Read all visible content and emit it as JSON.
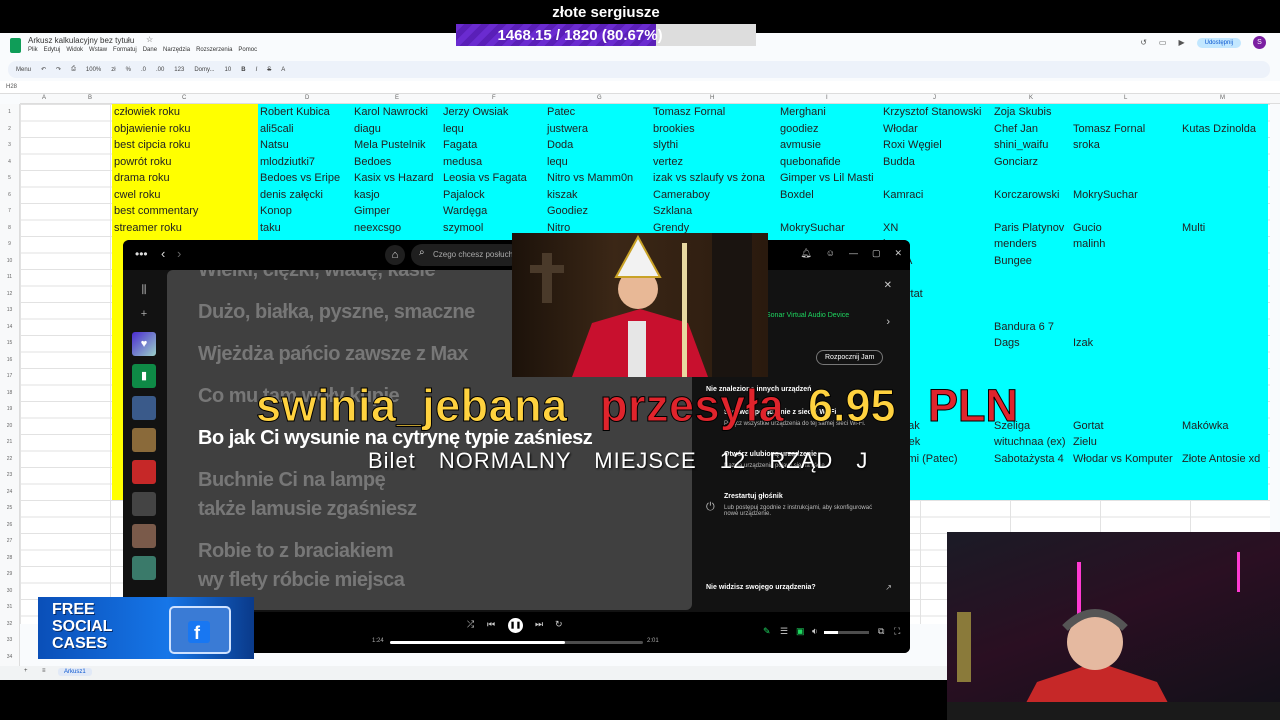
{
  "sheets": {
    "doc_title": "Arkusz kalkulacyjny bez tytułu",
    "menu": [
      "Plik",
      "Edytuj",
      "Widok",
      "Wstaw",
      "Formatuj",
      "Dane",
      "Narzędzia",
      "Rozszerzenia",
      "Pomoc"
    ],
    "share_label": "Udostępnij",
    "account_initial": "S",
    "toolbar": {
      "menu_label": "Menu",
      "zoom": "100%",
      "currency": "zł",
      "percent": "%",
      "dec_less": ".0",
      "dec_more": ".00",
      "number_fmt": "123",
      "font": "Domy...",
      "font_size": "10"
    },
    "cell_ref": "H28",
    "col_letters": [
      "A",
      "B",
      "C",
      "D",
      "E",
      "F",
      "G",
      "H",
      "I",
      "J",
      "K",
      "L",
      "M"
    ],
    "rows": [
      "1",
      "2",
      "3",
      "4",
      "5",
      "6",
      "7",
      "8",
      "9",
      "10",
      "11",
      "12",
      "13",
      "14",
      "15",
      "16",
      "17",
      "18",
      "19",
      "20",
      "21",
      "22",
      "23",
      "24",
      "25",
      "26",
      "27",
      "28",
      "29",
      "30",
      "31",
      "32",
      "33",
      "34",
      "35"
    ],
    "cells": [
      {
        "text": "człowiek roku",
        "col": 2,
        "row": 0
      },
      {
        "text": "objawienie roku",
        "col": 2,
        "row": 1
      },
      {
        "text": "best cipcia roku",
        "col": 2,
        "row": 2
      },
      {
        "text": "powrót roku",
        "col": 2,
        "row": 3
      },
      {
        "text": "drama roku",
        "col": 2,
        "row": 4
      },
      {
        "text": "cwel roku",
        "col": 2,
        "row": 5
      },
      {
        "text": "best commentary",
        "col": 2,
        "row": 6
      },
      {
        "text": "streamer roku",
        "col": 2,
        "row": 7
      },
      {
        "text": "Robert Kubica",
        "col": 3,
        "row": 0
      },
      {
        "text": "ali5cali",
        "col": 3,
        "row": 1
      },
      {
        "text": "Natsu",
        "col": 3,
        "row": 2
      },
      {
        "text": "mlodziutki7",
        "col": 3,
        "row": 3
      },
      {
        "text": "Bedoes vs Eripe",
        "col": 3,
        "row": 4
      },
      {
        "text": "denis załęcki",
        "col": 3,
        "row": 5
      },
      {
        "text": "Konop",
        "col": 3,
        "row": 6
      },
      {
        "text": "taku",
        "col": 3,
        "row": 7
      },
      {
        "text": "Karol Nawrocki",
        "col": 4,
        "row": 0
      },
      {
        "text": "diagu",
        "col": 4,
        "row": 1
      },
      {
        "text": "Mela Pustelnik",
        "col": 4,
        "row": 2
      },
      {
        "text": "Bedoes",
        "col": 4,
        "row": 3
      },
      {
        "text": "Kasix vs Hazard",
        "col": 4,
        "row": 4
      },
      {
        "text": "kasjo",
        "col": 4,
        "row": 5
      },
      {
        "text": "Gimper",
        "col": 4,
        "row": 6
      },
      {
        "text": "neexcsgo",
        "col": 4,
        "row": 7
      },
      {
        "text": "Jerzy Owsiak",
        "col": 5,
        "row": 0
      },
      {
        "text": "lequ",
        "col": 5,
        "row": 1
      },
      {
        "text": "Fagata",
        "col": 5,
        "row": 2
      },
      {
        "text": "medusa",
        "col": 5,
        "row": 3
      },
      {
        "text": "Leosia vs Fagata",
        "col": 5,
        "row": 4
      },
      {
        "text": "Pajalock",
        "col": 5,
        "row": 5
      },
      {
        "text": "Wardęga",
        "col": 5,
        "row": 6
      },
      {
        "text": "szymool",
        "col": 5,
        "row": 7
      },
      {
        "text": "Patec",
        "col": 6,
        "row": 0
      },
      {
        "text": "justwera",
        "col": 6,
        "row": 1
      },
      {
        "text": "Doda",
        "col": 6,
        "row": 2
      },
      {
        "text": "lequ",
        "col": 6,
        "row": 3
      },
      {
        "text": "Nitro vs Mamm0n",
        "col": 6,
        "row": 4
      },
      {
        "text": "kiszak",
        "col": 6,
        "row": 5
      },
      {
        "text": "Goodiez",
        "col": 6,
        "row": 6
      },
      {
        "text": "Nitro",
        "col": 6,
        "row": 7
      },
      {
        "text": "Tomasz Fornal",
        "col": 7,
        "row": 0
      },
      {
        "text": "brookies",
        "col": 7,
        "row": 1
      },
      {
        "text": "slythi",
        "col": 7,
        "row": 2
      },
      {
        "text": "vertez",
        "col": 7,
        "row": 3
      },
      {
        "text": "izak vs szlaufy vs żona",
        "col": 7,
        "row": 4
      },
      {
        "text": "Cameraboy",
        "col": 7,
        "row": 5
      },
      {
        "text": "Szklana",
        "col": 7,
        "row": 6
      },
      {
        "text": "Grendy",
        "col": 7,
        "row": 7
      },
      {
        "text": "Merghani",
        "col": 8,
        "row": 0
      },
      {
        "text": "goodiez",
        "col": 8,
        "row": 1
      },
      {
        "text": "avmusie",
        "col": 8,
        "row": 2
      },
      {
        "text": "quebonafide",
        "col": 8,
        "row": 3
      },
      {
        "text": "Gimper vs Lil Masti",
        "col": 8,
        "row": 4
      },
      {
        "text": "Boxdel",
        "col": 8,
        "row": 5
      },
      {
        "text": "MokrySuchar",
        "col": 8,
        "row": 7
      },
      {
        "text": "Krzysztof Stanowski",
        "col": 9,
        "row": 0
      },
      {
        "text": "Włodar",
        "col": 9,
        "row": 1
      },
      {
        "text": "Roxi Węgiel",
        "col": 9,
        "row": 2
      },
      {
        "text": "Budda",
        "col": 9,
        "row": 3
      },
      {
        "text": "Kamraci",
        "col": 9,
        "row": 5
      },
      {
        "text": "XN",
        "col": 9,
        "row": 7
      },
      {
        "text": "Zoja Skubis",
        "col": 10,
        "row": 0
      },
      {
        "text": "Chef Jan",
        "col": 10,
        "row": 1
      },
      {
        "text": "shini_waifu",
        "col": 10,
        "row": 2
      },
      {
        "text": "Gonciarz",
        "col": 10,
        "row": 3
      },
      {
        "text": "Korczarowski",
        "col": 10,
        "row": 5
      },
      {
        "text": "Paris Platynov",
        "col": 10,
        "row": 7
      },
      {
        "text": "menders",
        "col": 10,
        "row": 8
      },
      {
        "text": "Bungee",
        "col": 10,
        "row": 9
      },
      {
        "text": "Bandura 6 7",
        "col": 10,
        "row": 13
      },
      {
        "text": "Dags",
        "col": 10,
        "row": 14
      },
      {
        "text": "Szeliga",
        "col": 10,
        "row": 19
      },
      {
        "text": "wituchnaa (ex)",
        "col": 10,
        "row": 20
      },
      {
        "text": "Sabotażysta 4",
        "col": 10,
        "row": 21
      },
      {
        "text": "Tomasz Fornal",
        "col": 11,
        "row": 1
      },
      {
        "text": "sroka",
        "col": 11,
        "row": 2
      },
      {
        "text": "MokrySuchar",
        "col": 11,
        "row": 5
      },
      {
        "text": "Gucio",
        "col": 11,
        "row": 7
      },
      {
        "text": "malinh",
        "col": 11,
        "row": 8
      },
      {
        "text": "Izak",
        "col": 11,
        "row": 14
      },
      {
        "text": "Gortat",
        "col": 11,
        "row": 19
      },
      {
        "text": "Zielu",
        "col": 11,
        "row": 20
      },
      {
        "text": "Włodar vs Komputer",
        "col": 11,
        "row": 21
      },
      {
        "text": "Kutas Dzinolda",
        "col": 12,
        "row": 1
      },
      {
        "text": "Multi",
        "col": 12,
        "row": 7
      },
      {
        "text": "Makówka",
        "col": 12,
        "row": 19
      },
      {
        "text": "Złote Antosie xd",
        "col": 12,
        "row": 21
      },
      {
        "text": "ka",
        "col": 9,
        "row": 8
      },
      {
        "text": "APSA",
        "col": 9,
        "row": 9
      },
      {
        "text": "i tv",
        "col": 9,
        "row": 10
      },
      {
        "text": "n Gortat",
        "col": 9,
        "row": 11
      },
      {
        "text": "B",
        "col": 9,
        "row": 12
      },
      {
        "text": "ez",
        "col": 9,
        "row": 13
      },
      {
        "text": "m0n",
        "col": 9,
        "row": 14
      },
      {
        "text": "ies",
        "col": 9,
        "row": 15
      },
      {
        "text": "maxi",
        "col": 9,
        "row": 17
      },
      {
        "text": "n Polak",
        "col": 9,
        "row": 19
      },
      {
        "text": "Jadziek",
        "col": 9,
        "row": 20
      },
      {
        "text": "a Ziemi (Patec)",
        "col": 9,
        "row": 21
      },
      {
        "text": "zen",
        "col": 9,
        "row": 23
      }
    ],
    "sheet_tab": "Arkusz1"
  },
  "goal": {
    "title": "złote sergiusze",
    "progress_text": "1468.15 / 1820 (80.67%)",
    "current": 1468.15,
    "target": 1820,
    "percent": 80.67
  },
  "spotify": {
    "search_placeholder": "Czego chcesz posłuchać?",
    "lyrics": [
      {
        "text": "Wielki, ciężki, władę, kasie",
        "active": false
      },
      {
        "text": "Dużo, białka, pyszne, smaczne",
        "active": false
      },
      {
        "text": "Wjeżdża pańcio zawsze z Max",
        "active": false
      },
      {
        "text": "Co mu tam woły kupie",
        "active": false
      },
      {
        "text": "Bo jak Ci wysunie na cytrynę typie zaśniesz",
        "active": true
      },
      {
        "text": "Buchnie Ci na lampę",
        "active": false
      },
      {
        "text": "także lamusie zgaśniesz",
        "active": false
      },
      {
        "text": "Robie to z braciakiem",
        "active": false
      },
      {
        "text": "wy flety róbcie miejsca",
        "active": false
      }
    ],
    "devices": {
      "device_name": "Sonar Virtual Audio Device",
      "jam_label": "Rozpocznij Jam",
      "no_devices": "Nie znaleziono innych urządzeń",
      "check_wifi": "Sprawdź połączenie z siecią Wi-Fi",
      "check_wifi_sub": "Połącz wszystkie urządzenia do tej samej sieci Wi-Fi.",
      "open_app": "Otwórz ulubioną urządzenie",
      "open_app_sub": "Nazwa urządzenia pojawi się na liście.",
      "restart": "Zrestartuj głośnik",
      "restart_sub": "Lub postępuj zgodnie z instrukcjami, aby skonfigurować nowe urządzenie.",
      "cant_see": "Nie widzisz swojego urządzenia?"
    },
    "time_elapsed": "1:24",
    "time_total": "2:01",
    "progress_fraction": 0.69,
    "volume_fraction": 0.3
  },
  "donation": {
    "name": "swinia_jebana",
    "sends": "przesyła",
    "amount": "6.95",
    "currency": "PLN",
    "message": "Bilet NORMALNY MIEJSCE 12 RZĄD J"
  },
  "promo": {
    "text": "FREE SOCIAL CASES"
  },
  "colors": {
    "yellow": "#ffff00",
    "cyan": "#00ffff",
    "goal_fill": "#6a2bd0",
    "spotify_bg": "#121212",
    "accent_red": "#e0242c",
    "accent_gold": "#ffd23f"
  }
}
